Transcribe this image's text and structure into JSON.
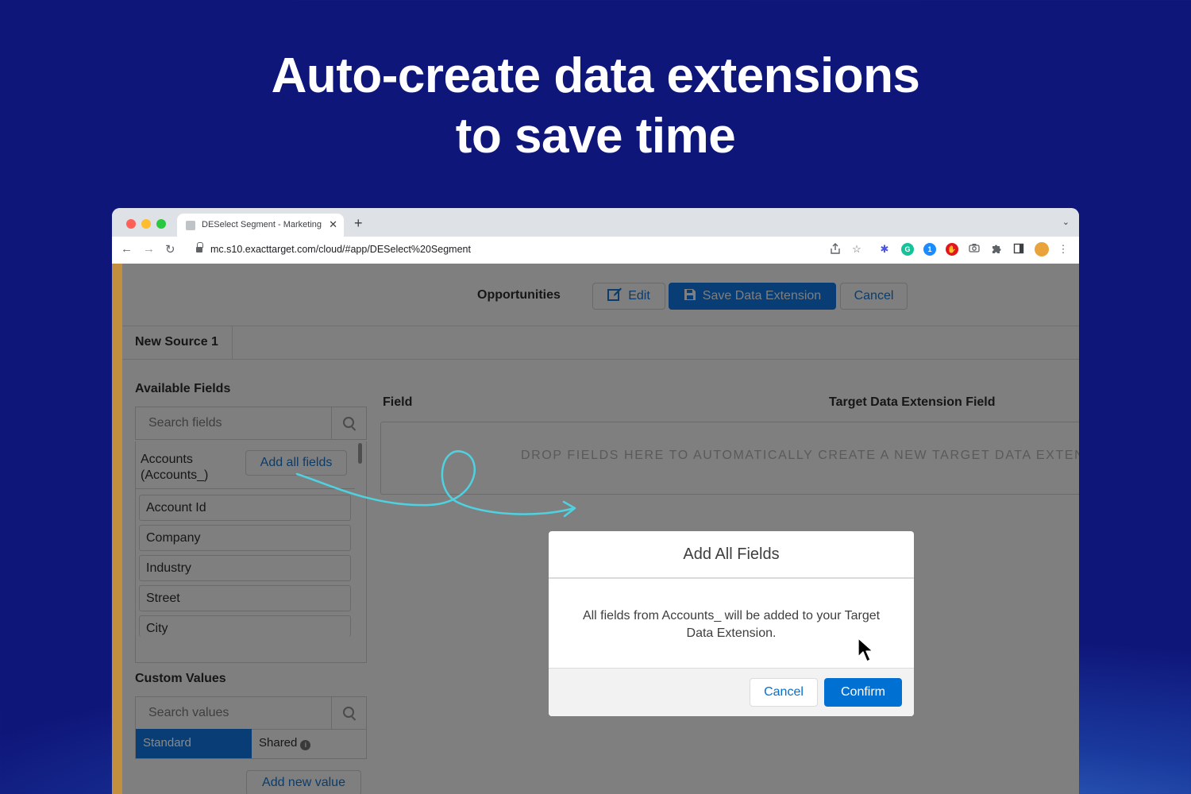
{
  "hero": {
    "line1": "Auto-create data extensions",
    "line2": "to save time"
  },
  "browser": {
    "tab_title": "DESelect Segment - Marketing Cloud",
    "tab_close": "✕",
    "new_tab": "+",
    "tab_menu": "⌄",
    "nav": {
      "back": "←",
      "forward": "→",
      "reload": "↻"
    },
    "url": "mc.s10.exacttarget.com/cloud/#app/DESelect%20Segment",
    "toolbar_icons": [
      "share-icon",
      "star-icon",
      "extension-perplexity-icon",
      "grammarly-icon",
      "onepassword-icon",
      "adblock-icon",
      "camera-icon",
      "puzzle-icon",
      "sidepanel-icon",
      "profile-avatar",
      "kebab-menu-icon"
    ]
  },
  "app": {
    "selection_name": "Opportunities",
    "edit_label": "Edit",
    "save_label": "Save Data Extension",
    "cancel_label": "Cancel",
    "source_tab": "New Source 1",
    "available_fields_label": "Available Fields",
    "search_fields_placeholder": "Search fields",
    "accounts_line1": "Accounts",
    "accounts_line2": "(Accounts_)",
    "add_all_fields": "Add all fields",
    "fields": [
      "Account Id",
      "Company",
      "Industry",
      "Street",
      "City"
    ],
    "custom_values_label": "Custom Values",
    "search_values_placeholder": "Search values",
    "tab_standard": "Standard",
    "tab_shared": "Shared",
    "info_glyph": "i",
    "add_new_value": "Add new value",
    "col_field": "Field",
    "col_target": "Target Data Extension Field",
    "drop_text": "DROP FIELDS HERE TO AUTOMATICALLY CREATE A NEW TARGET DATA EXTENSION"
  },
  "modal": {
    "title": "Add All Fields",
    "body": "All fields from Accounts_ will be added to your Target Data Extension.",
    "cancel": "Cancel",
    "confirm": "Confirm"
  },
  "colors": {
    "background": "#0f167a",
    "salesforce_blue": "#0070d2",
    "arrow": "#4fd1e0"
  }
}
